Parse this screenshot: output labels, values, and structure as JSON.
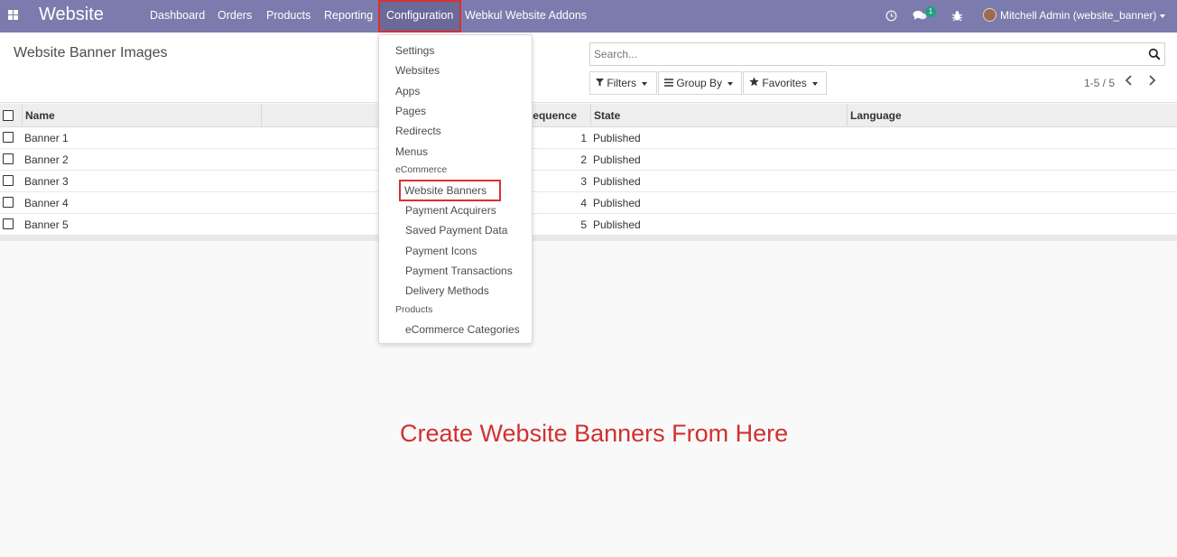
{
  "navbar": {
    "app_title": "Website",
    "menus": [
      "Dashboard",
      "Orders",
      "Products",
      "Reporting",
      "Configuration",
      "Webkul Website Addons"
    ],
    "messages_count": "1",
    "user_name": "Mitchell Admin (website_banner)"
  },
  "control_panel": {
    "title": "Website Banner Images",
    "search_placeholder": "Search...",
    "filters_label": "Filters",
    "group_by_label": "Group By",
    "favorites_label": "Favorites",
    "pager": "1-5 / 5"
  },
  "table": {
    "columns": [
      "Name",
      "Sequence",
      "State",
      "Language"
    ],
    "rows": [
      {
        "name": "Banner 1",
        "sequence": "1",
        "state": "Published",
        "language": ""
      },
      {
        "name": "Banner 2",
        "sequence": "2",
        "state": "Published",
        "language": ""
      },
      {
        "name": "Banner 3",
        "sequence": "3",
        "state": "Published",
        "language": ""
      },
      {
        "name": "Banner 4",
        "sequence": "4",
        "state": "Published",
        "language": ""
      },
      {
        "name": "Banner 5",
        "sequence": "5",
        "state": "Published",
        "language": ""
      }
    ]
  },
  "dropdown": {
    "items": [
      "Settings",
      "Websites",
      "Apps",
      "Pages",
      "Redirects",
      "Menus"
    ],
    "ecommerce_header": "eCommerce",
    "ecommerce_items": [
      "Website Banners",
      "Payment Acquirers",
      "Saved Payment Data",
      "Payment Icons",
      "Payment Transactions",
      "Delivery Methods"
    ],
    "products_header": "Products",
    "products_items": [
      "eCommerce Categories"
    ]
  },
  "annotation": "Create Website Banners From Here",
  "colors": {
    "navbar": "#7c7bad",
    "highlight_border": "#d93131",
    "annotation_text": "#d03131",
    "badge": "#20a07a"
  }
}
